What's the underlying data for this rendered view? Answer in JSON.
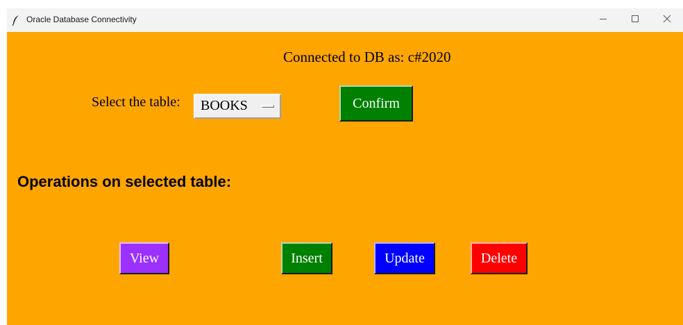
{
  "window": {
    "title": "Oracle Database Connectivity",
    "icon": "feather-icon",
    "controls": [
      "minimize-icon",
      "maximize-icon",
      "close-icon"
    ],
    "background_color": "#ffa500"
  },
  "connection": {
    "status_text": "Connected to DB as: c#2020"
  },
  "table_selector": {
    "label": "Select the table:",
    "selected_value": "BOOKS",
    "confirm_label": "Confirm"
  },
  "operations": {
    "heading": "Operations on selected table:",
    "buttons": [
      {
        "label": "View",
        "color": "#9b30ff"
      },
      {
        "label": "Insert",
        "color": "#008000"
      },
      {
        "label": "Update",
        "color": "#0000ff"
      },
      {
        "label": "Delete",
        "color": "#ff0000"
      }
    ]
  }
}
